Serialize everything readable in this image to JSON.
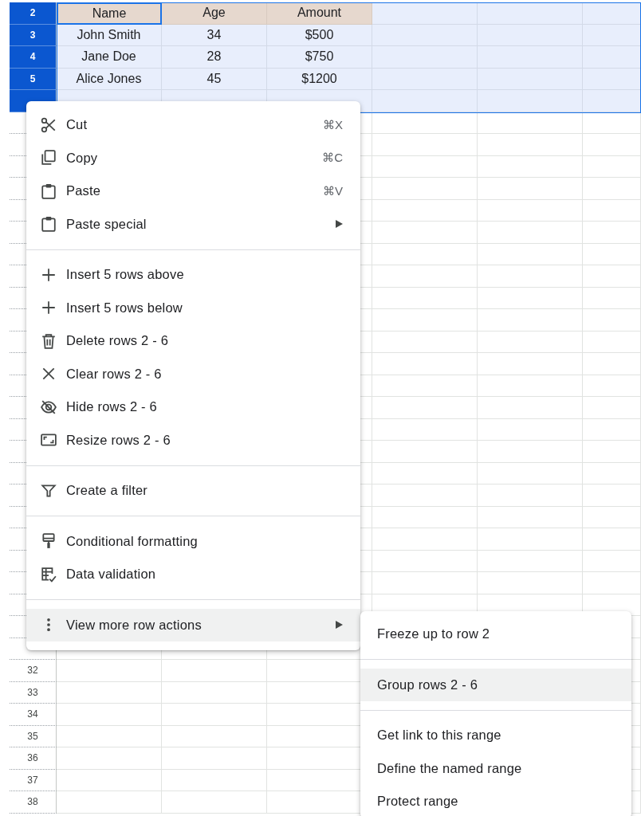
{
  "sheet": {
    "rows": [
      {
        "number": "2",
        "kind": "header",
        "selected": true,
        "cells": [
          {
            "text": "Name",
            "active": true
          },
          {
            "text": "Age",
            "active": false
          },
          {
            "text": "Amount",
            "active": false
          }
        ]
      },
      {
        "number": "3",
        "kind": "data",
        "selected": true,
        "cells": [
          {
            "text": "John Smith",
            "active": false
          },
          {
            "text": "34",
            "active": false
          },
          {
            "text": "$500",
            "active": false
          }
        ]
      },
      {
        "number": "4",
        "kind": "data",
        "selected": true,
        "cells": [
          {
            "text": "Jane Doe",
            "active": false
          },
          {
            "text": "28",
            "active": false
          },
          {
            "text": "$750",
            "active": false
          }
        ]
      },
      {
        "number": "5",
        "kind": "data",
        "selected": true,
        "cells": [
          {
            "text": "Alice Jones",
            "active": false
          },
          {
            "text": "45",
            "active": false
          },
          {
            "text": "$1200",
            "active": false
          }
        ]
      },
      {
        "kind": "data",
        "selected": true
      }
    ],
    "lower_rows": [
      {
        "number": "32",
        "selected": false
      },
      {
        "number": "33",
        "selected": false
      },
      {
        "number": "34",
        "selected": false
      },
      {
        "number": "35",
        "selected": false
      },
      {
        "number": "36",
        "selected": false
      },
      {
        "number": "37",
        "selected": false
      },
      {
        "number": "38",
        "selected": false
      }
    ]
  },
  "context_menu": {
    "items": [
      {
        "kind": "command",
        "label": "Cut",
        "shortcut": "⌘X",
        "highlighted": false
      },
      {
        "kind": "command",
        "label": "Copy",
        "shortcut": "⌘C",
        "highlighted": false
      },
      {
        "kind": "command",
        "label": "Paste",
        "shortcut": "⌘V",
        "highlighted": false
      },
      {
        "kind": "submenu",
        "label": "Paste special",
        "highlighted": false
      },
      {
        "kind": "separator"
      },
      {
        "kind": "command",
        "label": "Insert 5 rows above",
        "highlighted": false
      },
      {
        "kind": "command",
        "label": "Insert 5 rows below",
        "highlighted": false
      },
      {
        "kind": "command",
        "label": "Delete rows 2 - 6",
        "highlighted": false
      },
      {
        "kind": "command",
        "label": "Clear rows 2 - 6",
        "highlighted": false
      },
      {
        "kind": "command",
        "label": "Hide rows 2 - 6",
        "highlighted": false
      },
      {
        "kind": "command",
        "label": "Resize rows 2 - 6",
        "highlighted": false
      },
      {
        "kind": "separator"
      },
      {
        "kind": "command",
        "label": "Create a filter",
        "highlighted": false
      },
      {
        "kind": "separator"
      },
      {
        "kind": "command",
        "label": "Conditional formatting",
        "highlighted": false
      },
      {
        "kind": "command",
        "label": "Data validation",
        "highlighted": false
      },
      {
        "kind": "separator"
      },
      {
        "kind": "submenu",
        "label": "View more row actions",
        "highlighted": true
      }
    ]
  },
  "submenu": {
    "items": [
      {
        "kind": "command",
        "label": "Freeze up to row 2",
        "highlighted": false
      },
      {
        "kind": "separator"
      },
      {
        "kind": "command",
        "label": "Group rows 2 - 6",
        "highlighted": true
      },
      {
        "kind": "separator"
      },
      {
        "kind": "command",
        "label": "Get link to this range",
        "highlighted": false
      },
      {
        "kind": "command",
        "label": "Define the named range",
        "highlighted": false
      },
      {
        "kind": "command",
        "label": "Protect range",
        "highlighted": false
      }
    ]
  }
}
